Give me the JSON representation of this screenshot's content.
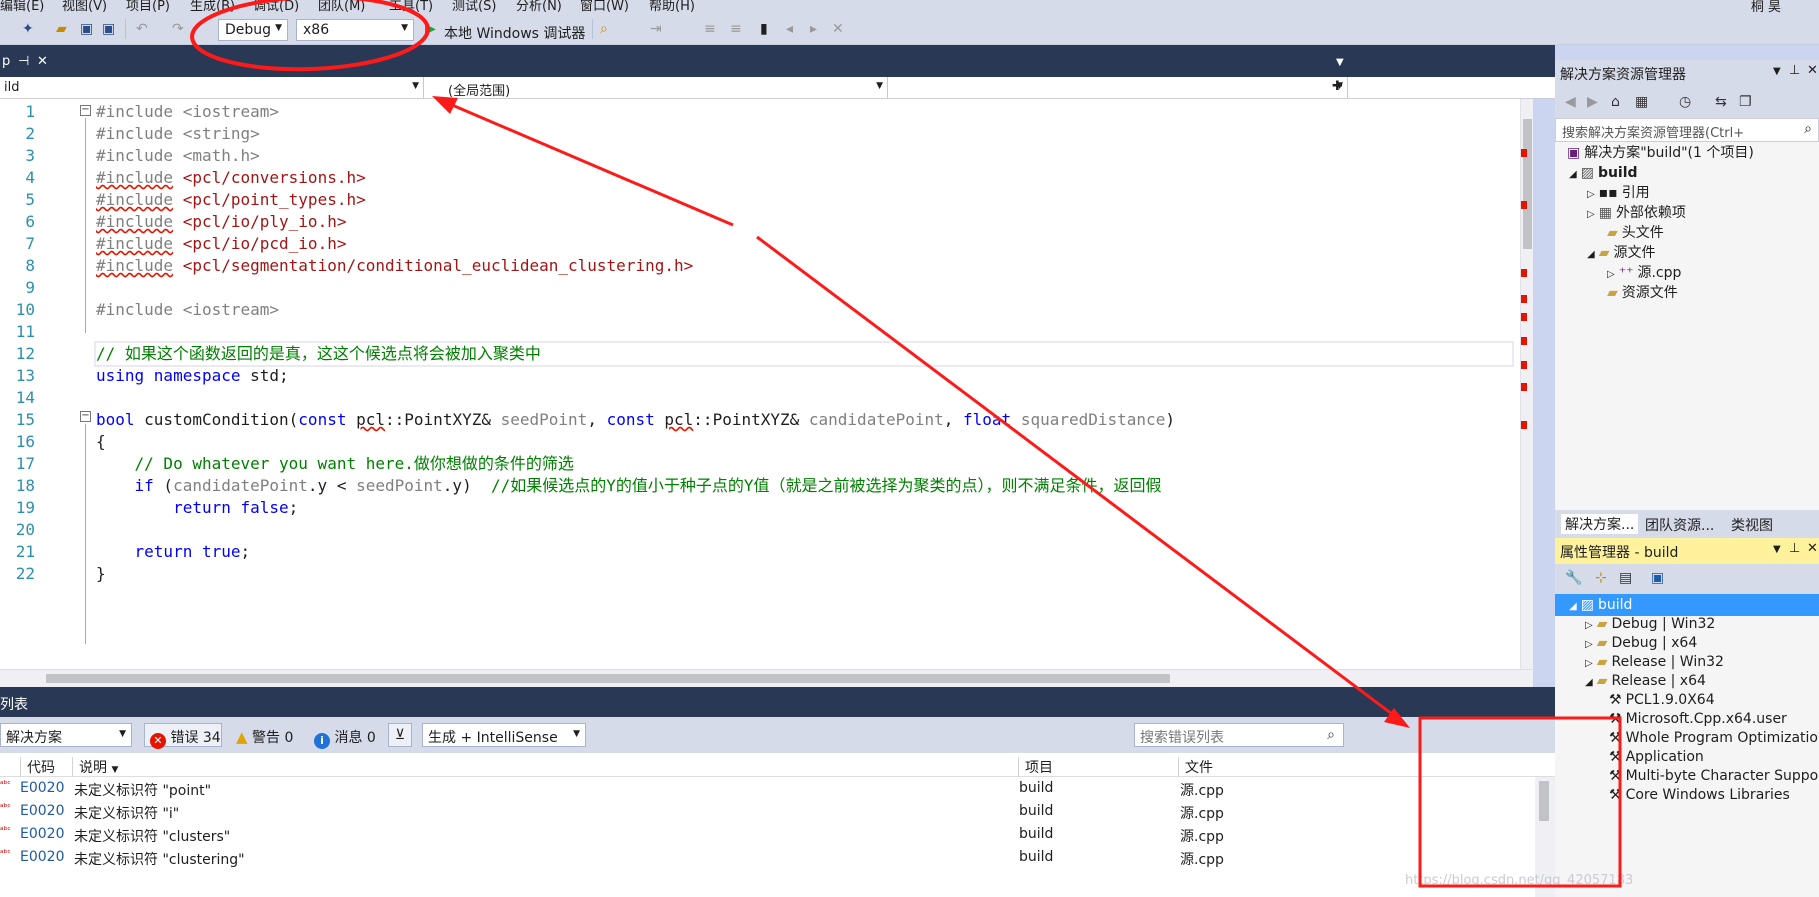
{
  "menu": {
    "items": [
      "编辑(E)",
      "视图(V)",
      "项目(P)",
      "生成(B)",
      "调试(D)",
      "团队(M)",
      "工具(T)",
      "测试(S)",
      "分析(N)",
      "窗口(W)",
      "帮助(H)"
    ],
    "user": "桐 昊"
  },
  "toolbar": {
    "config": "Debug",
    "platform": "x86",
    "run_label": "本地 Windows 调试器"
  },
  "tabs": {
    "doc_tab_label": "p",
    "pin_glyph": "⊣",
    "close_glyph": "✕"
  },
  "navbar": {
    "project": "ild",
    "scope": "(全局范围)",
    "member": ""
  },
  "editor": {
    "lines": [
      {
        "n": "1",
        "t": "#include <iostream>"
      },
      {
        "n": "2",
        "t": "#include <string>"
      },
      {
        "n": "3",
        "t": "#include <math.h>"
      },
      {
        "n": "4",
        "t": "#include <pcl/conversions.h>"
      },
      {
        "n": "5",
        "t": "#include <pcl/point_types.h>"
      },
      {
        "n": "6",
        "t": "#include <pcl/io/ply_io.h>"
      },
      {
        "n": "7",
        "t": "#include <pcl/io/pcd_io.h>"
      },
      {
        "n": "8",
        "t": "#include <pcl/segmentation/conditional_euclidean_clustering.h>"
      },
      {
        "n": "9",
        "t": ""
      },
      {
        "n": "10",
        "t": "#include <iostream>"
      },
      {
        "n": "11",
        "t": ""
      },
      {
        "n": "12",
        "t": "// 如果这个函数返回的是真，这这个候选点将会被加入聚类中"
      },
      {
        "n": "13",
        "t": "using namespace std;"
      },
      {
        "n": "14",
        "t": ""
      },
      {
        "n": "15",
        "t": "bool customCondition(const pcl::PointXYZ& seedPoint, const pcl::PointXYZ& candidatePoint, float squaredDistance)"
      },
      {
        "n": "16",
        "t": "{"
      },
      {
        "n": "17",
        "t": "    // Do whatever you want here.做你想做的条件的筛选"
      },
      {
        "n": "18",
        "t": "    if (candidatePoint.y < seedPoint.y)  //如果候选点的Y的值小于种子点的Y值（就是之前被选择为聚类的点），则不满足条件，返回假"
      },
      {
        "n": "19",
        "t": "        return false;"
      },
      {
        "n": "20",
        "t": ""
      },
      {
        "n": "21",
        "t": "    return true;"
      },
      {
        "n": "22",
        "t": "}"
      }
    ]
  },
  "error_list": {
    "title": "列表",
    "scope": "解决方案",
    "errors_label": "错误 34",
    "warnings_label": "警告 0",
    "messages_label": "消息 0",
    "build_filter": "生成 + IntelliSense",
    "search_placeholder": "搜索错误列表",
    "columns": {
      "code": "代码",
      "desc": "说明",
      "project": "项目",
      "file": "文件"
    },
    "rows": [
      {
        "code": "E0020",
        "desc": "未定义标识符 \"point\"",
        "project": "build",
        "file": "源.cpp"
      },
      {
        "code": "E0020",
        "desc": "未定义标识符 \"i\"",
        "project": "build",
        "file": "源.cpp"
      },
      {
        "code": "E0020",
        "desc": "未定义标识符 \"clusters\"",
        "project": "build",
        "file": "源.cpp"
      },
      {
        "code": "E0020",
        "desc": "未定义标识符 \"clustering\"",
        "project": "build",
        "file": "源.cpp"
      }
    ]
  },
  "solution_explorer": {
    "title": "解决方案资源管理器",
    "search_placeholder": "搜索解决方案资源管理器(Ctrl+",
    "solution": "解决方案\"build\"(1 个项目)",
    "project": "build",
    "items": [
      "引用",
      "外部依赖项",
      "头文件",
      "源文件",
      "源.cpp",
      "资源文件"
    ],
    "bottom_tabs": [
      "解决方案...",
      "团队资源...",
      "类视图"
    ]
  },
  "property_manager": {
    "title": "属性管理器 - build",
    "root": "build",
    "configs": [
      "Debug | Win32",
      "Debug | x64",
      "Release | Win32",
      "Release | x64"
    ],
    "sheets": [
      "PCL1.9.0X64",
      "Microsoft.Cpp.x64.user",
      "Whole Program Optimization",
      "Application",
      "Multi-byte Character Support",
      "Core Windows Libraries"
    ]
  },
  "watermark": "https://blog.csdn.net/qq_42057183",
  "colors": {
    "annotation": "#ff1a1a",
    "keyword": "#0000ff",
    "comment": "#008000",
    "include_path": "#a31515"
  }
}
